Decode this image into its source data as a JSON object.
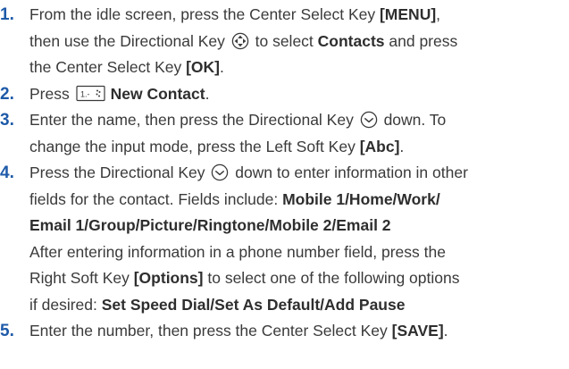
{
  "steps": [
    {
      "number": "1.",
      "lines": [
        [
          {
            "t": "text",
            "v": "From the idle screen, press the Center Select Key "
          },
          {
            "t": "bold",
            "v": "[MENU]"
          },
          {
            "t": "text",
            "v": ","
          }
        ],
        [
          {
            "t": "text",
            "v": "then use the Directional Key "
          },
          {
            "t": "icon",
            "v": "directional-4way-icon"
          },
          {
            "t": "text",
            "v": " to select "
          },
          {
            "t": "bold",
            "v": "Contacts"
          },
          {
            "t": "text",
            "v": " and press"
          }
        ],
        [
          {
            "t": "text",
            "v": "the Center Select Key "
          },
          {
            "t": "bold",
            "v": "[OK]"
          },
          {
            "t": "text",
            "v": "."
          }
        ]
      ]
    },
    {
      "number": "2.",
      "lines": [
        [
          {
            "t": "text",
            "v": "Press "
          },
          {
            "t": "icon",
            "v": "key-1-icon"
          },
          {
            "t": "bold",
            "v": "New Contact"
          },
          {
            "t": "text",
            "v": "."
          }
        ]
      ]
    },
    {
      "number": "3.",
      "lines": [
        [
          {
            "t": "text",
            "v": "Enter the name, then press the Directional Key "
          },
          {
            "t": "icon",
            "v": "directional-down-icon"
          },
          {
            "t": "text",
            "v": " down. To"
          }
        ],
        [
          {
            "t": "text",
            "v": "change the input mode, press the Left Soft Key "
          },
          {
            "t": "bold",
            "v": "[Abc]"
          },
          {
            "t": "text",
            "v": "."
          }
        ]
      ]
    },
    {
      "number": "4.",
      "lines": [
        [
          {
            "t": "text",
            "v": "Press the Directional Key "
          },
          {
            "t": "icon",
            "v": "directional-down-icon"
          },
          {
            "t": "text",
            "v": " down to enter information in other"
          }
        ],
        [
          {
            "t": "text",
            "v": "fields for the contact. Fields include: "
          },
          {
            "t": "bold",
            "v": "Mobile 1/Home/Work/"
          }
        ],
        [
          {
            "t": "bold",
            "v": "Email 1/Group/Picture/Ringtone/Mobile 2/Email 2"
          }
        ],
        [
          {
            "t": "text",
            "v": "After entering information in a phone number field, press the"
          }
        ],
        [
          {
            "t": "text",
            "v": "Right Soft Key "
          },
          {
            "t": "bold",
            "v": "[Options]"
          },
          {
            "t": "text",
            "v": " to select one of the following options"
          }
        ],
        [
          {
            "t": "text",
            "v": "if desired: "
          },
          {
            "t": "bold",
            "v": "Set Speed Dial/Set As Default/Add Pause"
          }
        ]
      ]
    },
    {
      "number": "5.",
      "lines": [
        [
          {
            "t": "text",
            "v": "Enter the number, then press the Center Select Key "
          },
          {
            "t": "bold",
            "v": "[SAVE]"
          },
          {
            "t": "text",
            "v": "."
          }
        ]
      ]
    }
  ]
}
